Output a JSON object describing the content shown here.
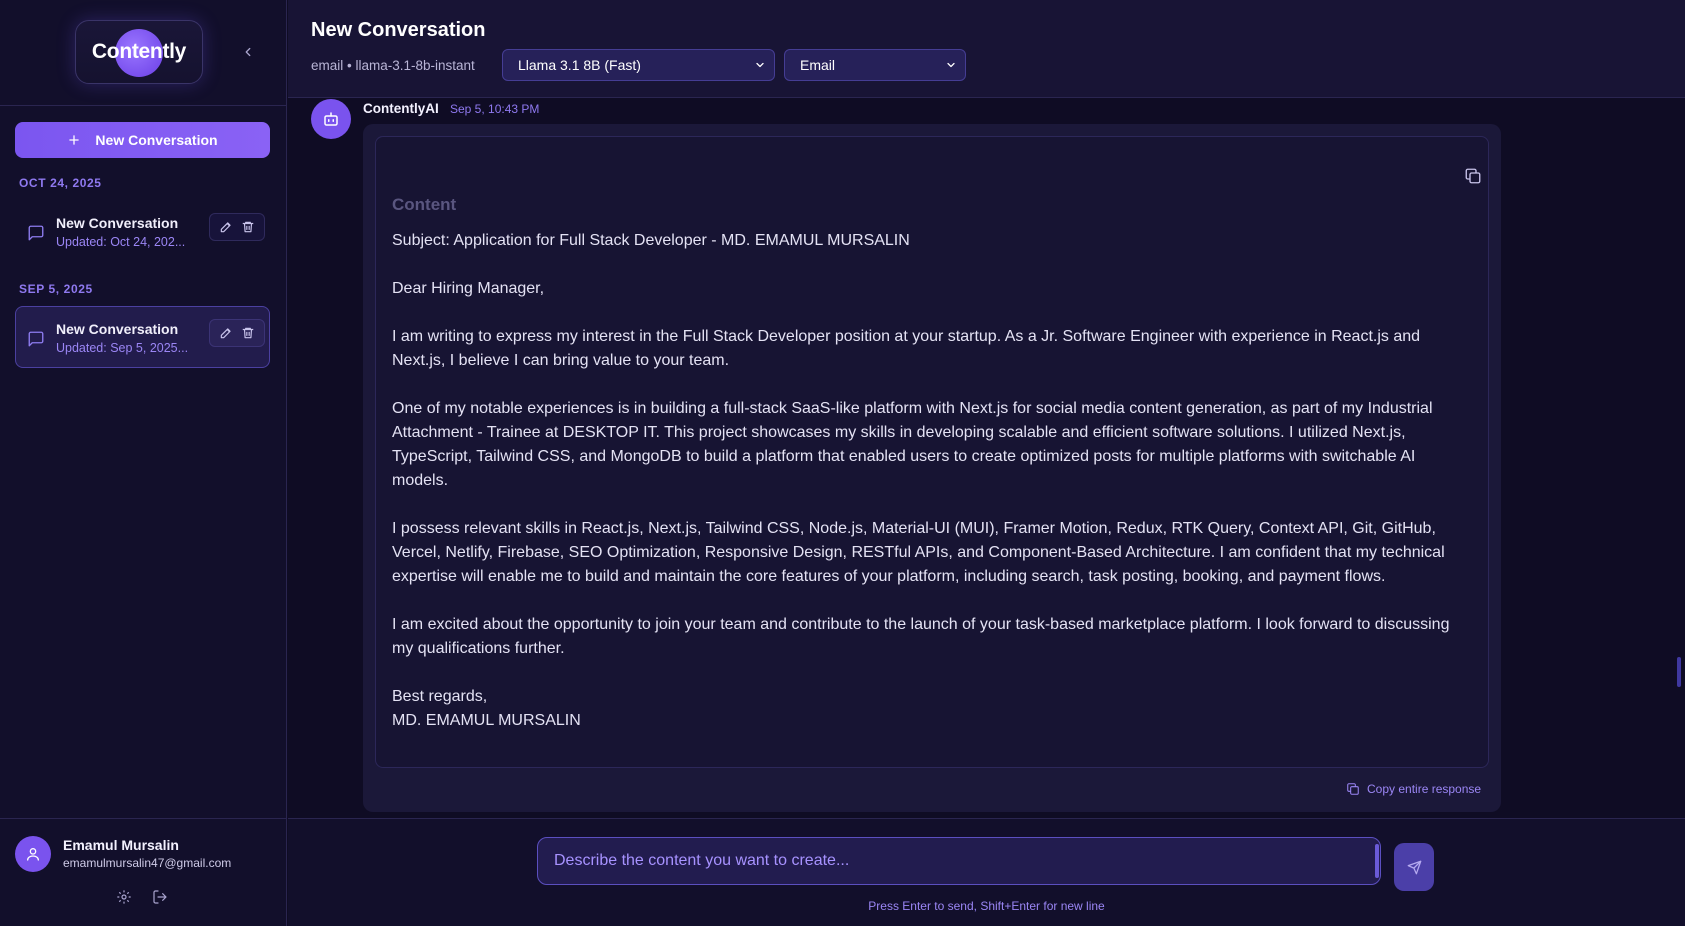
{
  "brand": {
    "logo_text": "Contently"
  },
  "sidebar": {
    "new_conversation_label": "New Conversation",
    "groups": [
      {
        "date_label": "OCT 24, 2025",
        "items": [
          {
            "title": "New Conversation",
            "updated": "Updated: Oct 24, 202...",
            "active": false
          }
        ]
      },
      {
        "date_label": "SEP 5, 2025",
        "items": [
          {
            "title": "New Conversation",
            "updated": "Updated: Sep 5, 2025...",
            "active": true
          }
        ]
      }
    ],
    "user": {
      "name": "Emamul Mursalin",
      "email": "emamulmursalin47@gmail.com"
    }
  },
  "header": {
    "title": "New Conversation",
    "meta": "email • llama-3.1-8b-instant",
    "model_select": "Llama 3.1 8B (Fast)",
    "type_select": "Email"
  },
  "message": {
    "sender": "ContentlyAI",
    "time": "Sep 5, 10:43 PM",
    "content_heading": "Content",
    "paragraphs": [
      "Subject: Application for Full Stack Developer - MD. EMAMUL MURSALIN",
      "Dear Hiring Manager,",
      "I am writing to express my interest in the Full Stack Developer position at your startup. As a Jr. Software Engineer with experience in React.js and Next.js, I believe I can bring value to your team.",
      "One of my notable experiences is in building a full-stack SaaS-like platform with Next.js for social media content generation, as part of my Industrial Attachment - Trainee at DESKTOP IT. This project showcases my skills in developing scalable and efficient software solutions. I utilized Next.js, TypeScript, Tailwind CSS, and MongoDB to build a platform that enabled users to create optimized posts for multiple platforms with switchable AI models.",
      "I possess relevant skills in React.js, Next.js, Tailwind CSS, Node.js, Material-UI (MUI), Framer Motion, Redux, RTK Query, Context API, Git, GitHub, Vercel, Netlify, Firebase, SEO Optimization, Responsive Design, RESTful APIs, and Component-Based Architecture. I am confident that my technical expertise will enable me to build and maintain the core features of your platform, including search, task posting, booking, and payment flows.",
      "I am excited about the opportunity to join your team and contribute to the launch of your task-based marketplace platform. I look forward to discussing my qualifications further."
    ],
    "signoff": "Best regards,",
    "signature": "MD. EMAMUL MURSALIN",
    "copy_all_label": "Copy entire response"
  },
  "composer": {
    "placeholder": "Describe the content you want to create...",
    "hint": "Press Enter to send, Shift+Enter for new line"
  },
  "colors": {
    "accent": "#7b56f0",
    "accent_text": "#9b86f5",
    "background": "#0f0c24",
    "panel": "#181435"
  }
}
